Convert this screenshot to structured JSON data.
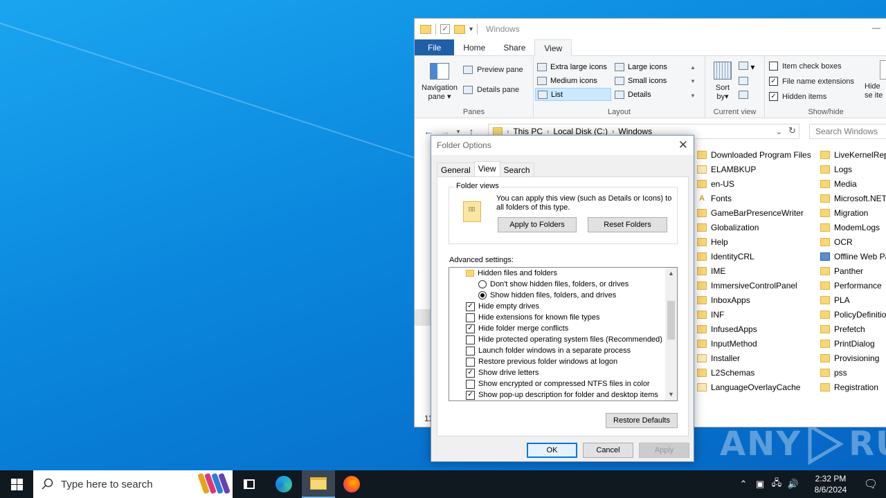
{
  "explorer": {
    "title": "Windows",
    "ribbon_tabs": [
      "File",
      "Home",
      "Share",
      "View"
    ],
    "panes": {
      "navigation_pane": "Navigation pane",
      "preview_pane": "Preview pane",
      "details_pane": "Details pane",
      "group_label": "Panes"
    },
    "layout": {
      "items": [
        "Extra large icons",
        "Large icons",
        "Medium icons",
        "Small icons",
        "List",
        "Details"
      ],
      "selected": "List",
      "group_label": "Layout"
    },
    "current_view": {
      "sort_by": "Sort by",
      "group_label": "Current view"
    },
    "show_hide": {
      "item_check_boxes": "Item check boxes",
      "file_name_extensions": "File name extensions",
      "hidden_items": "Hidden items",
      "hide_selected": "Hide se ite",
      "group_label": "Show/hide"
    },
    "breadcrumb": [
      "This PC",
      "Local Disk (C:)",
      "Windows"
    ],
    "search_placeholder": "Search Windows",
    "files_col1": [
      "Downloaded Program Files",
      "ELAMBKUP",
      "en-US",
      "Fonts",
      "GameBarPresenceWriter",
      "Globalization",
      "Help",
      "IdentityCRL",
      "IME",
      "ImmersiveControlPanel",
      "InboxApps",
      "INF",
      "InfusedApps",
      "InputMethod",
      "Installer",
      "L2Schemas",
      "LanguageOverlayCache"
    ],
    "files_col2": [
      "LiveKernelRepo",
      "Logs",
      "Media",
      "Microsoft.NET",
      "Migration",
      "ModemLogs",
      "OCR",
      "Offline Web Pa",
      "Panther",
      "Performance",
      "PLA",
      "PolicyDefinitio",
      "Prefetch",
      "PrintDialog",
      "Provisioning",
      "pss",
      "Registration"
    ],
    "status_count": "11"
  },
  "dialog": {
    "title": "Folder Options",
    "tabs": [
      "General",
      "View",
      "Search"
    ],
    "folder_views_legend": "Folder views",
    "folder_views_text": "You can apply this view (such as Details or Icons) to all folders of this type.",
    "apply_to_folders": "Apply to Folders",
    "reset_folders": "Reset Folders",
    "advanced_label": "Advanced settings:",
    "advanced_items": {
      "hidden_folder": "Hidden files and folders",
      "dont_show": "Don't show hidden files, folders, or drives",
      "show_hidden": "Show hidden files, folders, and drives",
      "hide_empty": "Hide empty drives",
      "hide_ext": "Hide extensions for known file types",
      "hide_merge": "Hide folder merge conflicts",
      "hide_protected": "Hide protected operating system files (Recommended)",
      "launch_separate": "Launch folder windows in a separate process",
      "restore_prev": "Restore previous folder windows at logon",
      "show_drive": "Show drive letters",
      "show_encrypted": "Show encrypted or compressed NTFS files in color",
      "show_popup": "Show pop-up description for folder and desktop items"
    },
    "restore_defaults": "Restore Defaults",
    "ok": "OK",
    "cancel": "Cancel",
    "apply": "Apply"
  },
  "taskbar": {
    "search_placeholder": "Type here to search",
    "time": "2:32 PM",
    "date": "8/6/2024"
  },
  "watermark": {
    "left": "ANY",
    "right": "RUN"
  },
  "colors": {
    "accent": "#0078d7",
    "desktop": "#0a86dc",
    "taskbar": "#101820"
  }
}
